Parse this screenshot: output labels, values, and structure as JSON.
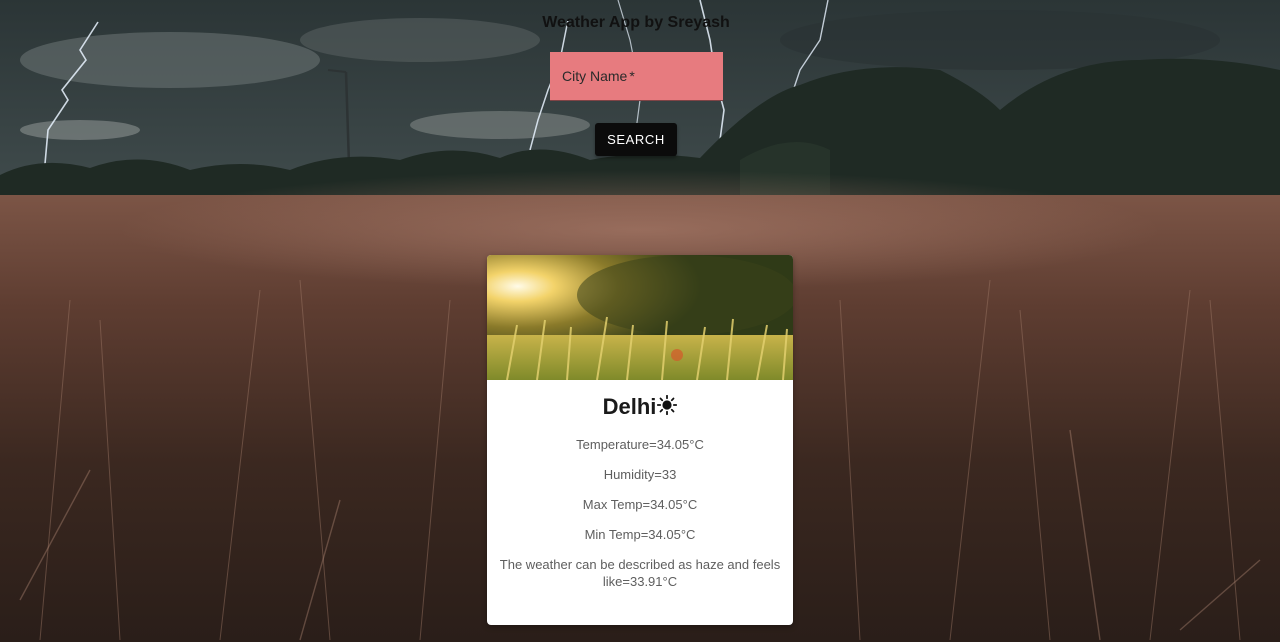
{
  "header": {
    "title": "Weather App by Sreyash"
  },
  "search": {
    "label": "City Name",
    "required_marker": "*",
    "value": "",
    "button_label": "SEARCH"
  },
  "weather_card": {
    "city": "Delhi",
    "condition_icon": "sun-icon",
    "temperature": "Temperature=34.05°C",
    "humidity": "Humidity=33",
    "max_temp": "Max Temp=34.05°C",
    "min_temp": "Min Temp=34.05°C",
    "description": "The weather can be described as haze and feels like=33.91°C"
  },
  "colors": {
    "input_background": "#e77b7f",
    "button_background": "#0b0b0b",
    "card_background": "#ffffff"
  }
}
